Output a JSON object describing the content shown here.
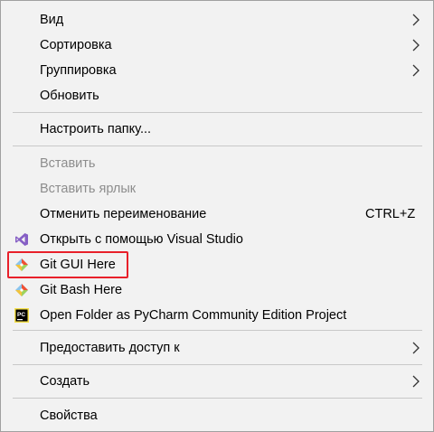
{
  "menu": {
    "items": [
      {
        "label": "Вид"
      },
      {
        "label": "Сортировка"
      },
      {
        "label": "Группировка"
      },
      {
        "label": "Обновить"
      },
      {
        "label": "Настроить папку..."
      },
      {
        "label": "Вставить"
      },
      {
        "label": "Вставить ярлык"
      },
      {
        "label": "Отменить переименование",
        "shortcut": "CTRL+Z"
      },
      {
        "label": "Открыть с помощью Visual Studio"
      },
      {
        "label": "Git GUI Here"
      },
      {
        "label": "Git Bash Here"
      },
      {
        "label": "Open Folder as PyCharm Community Edition Project",
        "icon_text": "PC"
      },
      {
        "label": "Предоставить доступ к"
      },
      {
        "label": "Создать"
      },
      {
        "label": "Свойства"
      }
    ]
  },
  "icons": {
    "visual_studio": "visual-studio-icon",
    "git_gui": "git-gui-icon",
    "git_bash": "git-bash-icon",
    "pycharm": "pycharm-icon",
    "submenu": "chevron-right-icon"
  },
  "colors": {
    "highlight_border": "#e8202a",
    "disabled_text": "#8d8d8d",
    "vs_purple": "#865fc5",
    "pycharm_bg": "#000000",
    "git_orange": "#f05033"
  }
}
